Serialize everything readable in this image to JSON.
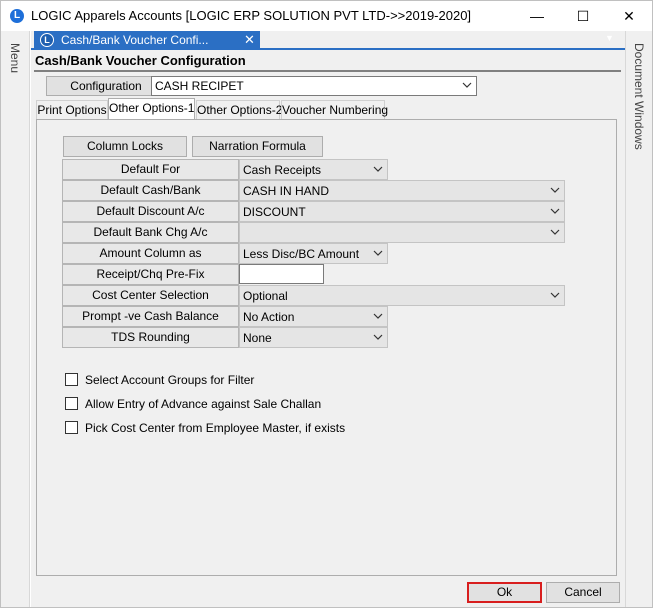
{
  "window": {
    "title": "LOGIC Apparels Accounts  [LOGIC ERP SOLUTION PVT LTD->>2019-2020]",
    "minimize": "—",
    "maximize": "☐",
    "close": "✕"
  },
  "rails": {
    "left_label": "Menu",
    "right_label": "Document Windows"
  },
  "doc_tab": {
    "label": "Cash/Bank Voucher Confi...",
    "close": "✕",
    "strip_arrow": "▼"
  },
  "form": {
    "heading": "Cash/Bank Voucher Configuration",
    "configuration_button": "Configuration",
    "configuration_value": "CASH RECIPET"
  },
  "tabs": [
    {
      "label": "Print Options"
    },
    {
      "label": "Other Options-1"
    },
    {
      "label": "Other Options-2"
    },
    {
      "label": "Voucher Numbering"
    }
  ],
  "panel_buttons": {
    "column_locks": "Column Locks",
    "narration_formula": "Narration Formula"
  },
  "settings": [
    {
      "label": "Default For",
      "value": "Cash Receipts"
    },
    {
      "label": "Default Cash/Bank",
      "value": "CASH IN HAND"
    },
    {
      "label": "Default Discount A/c",
      "value": "DISCOUNT"
    },
    {
      "label": "Default Bank Chg A/c",
      "value": ""
    },
    {
      "label": "Amount Column as",
      "value": "Less Disc/BC Amount"
    },
    {
      "label": "Receipt/Chq Pre-Fix",
      "value": ""
    },
    {
      "label": "Cost Center Selection",
      "value": "Optional"
    },
    {
      "label": "Prompt -ve Cash Balance",
      "value": "No Action"
    },
    {
      "label": "TDS Rounding",
      "value": "None"
    }
  ],
  "checkboxes": [
    {
      "label": "Select Account Groups for Filter",
      "checked": false
    },
    {
      "label": "Allow Entry of Advance against Sale Challan",
      "checked": false
    },
    {
      "label": "Pick Cost Center from Employee Master, if exists",
      "checked": false
    }
  ],
  "footer": {
    "ok": "Ok",
    "cancel": "Cancel"
  },
  "colors": {
    "accent": "#2b6fc4",
    "ok_border": "#d81e1e"
  }
}
